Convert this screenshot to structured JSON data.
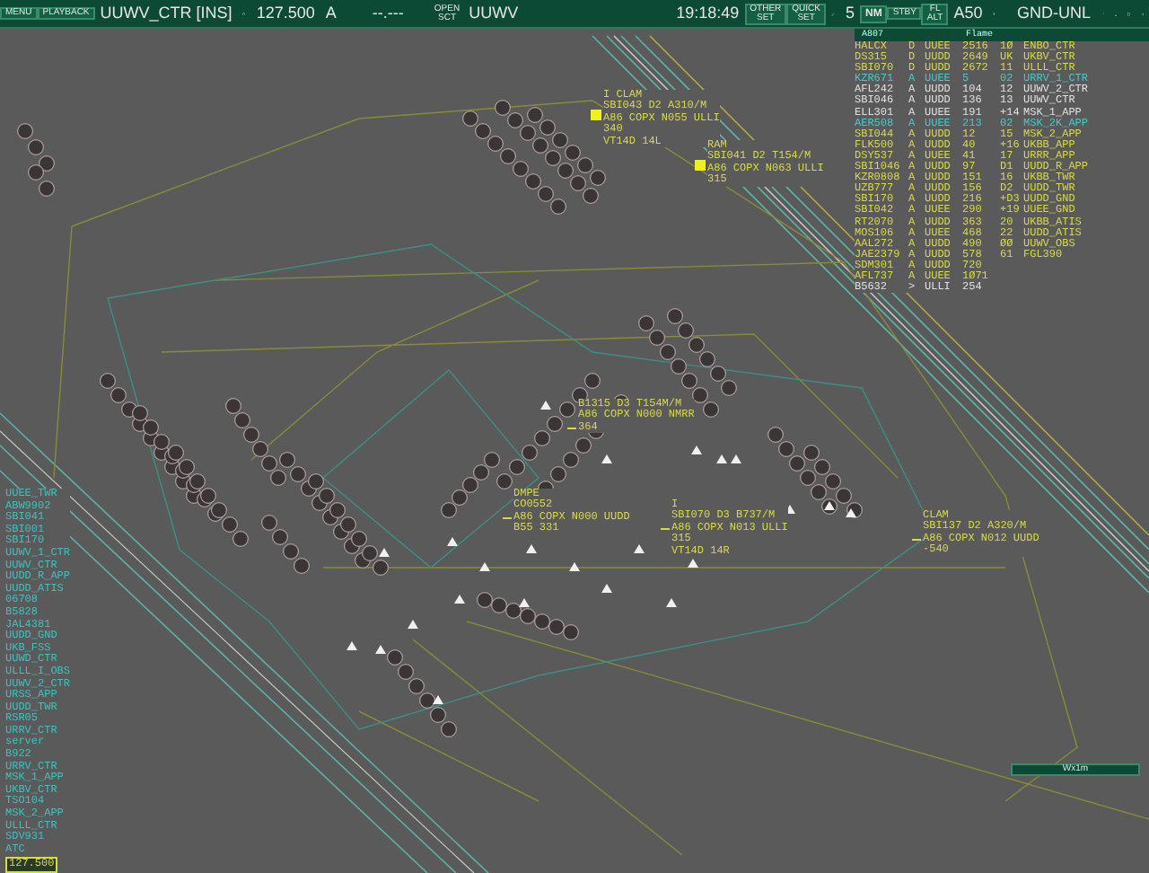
{
  "toolbar": {
    "menu_button": "MENU",
    "playback_button": "PLAYBACK",
    "sector": "UUWV_CTR [INS]",
    "frequency": "127.500",
    "mode": "A",
    "secondary_frequency": "--.---",
    "open_sector_button": [
      "OPEN",
      "SCT"
    ],
    "sector_code": "UUWV",
    "time": "19:18:49",
    "other_set_button": [
      "OTHER",
      "SET"
    ],
    "quick_set_button": [
      "QUICK",
      "SET"
    ],
    "range": "5",
    "unit": "NM",
    "standby_button": [
      "STBY"
    ],
    "fl_alt_button": [
      "FL",
      "ALT"
    ],
    "level": "A50",
    "altitude_filter": "GND-UNL"
  },
  "flight_list": {
    "header": [
      "A807",
      "Flame"
    ],
    "rows": [
      {
        "callsign": "HALCX",
        "type": "D",
        "airport": "UUEE",
        "number": "2516",
        "column_5": "1Ø",
        "position": "ENBO_CTR",
        "color": "#d8d848"
      },
      {
        "callsign": "DS315",
        "type": "D",
        "airport": "UUDD",
        "number": "2649",
        "column_5": "UK",
        "position": "UKBV_CTR",
        "color": "#d8d848"
      },
      {
        "callsign": "SBI070",
        "type": "D",
        "airport": "UUDD",
        "number": "2672",
        "column_5": "11",
        "position": "ULLL_CTR",
        "color": "#d8d848"
      },
      {
        "callsign": "KZR671",
        "type": "A",
        "airport": "UUEE",
        "number": "5",
        "column_5": "02",
        "position": "URRV_1_CTR",
        "color": "#48c8c8"
      },
      {
        "callsign": "AFL242",
        "type": "A",
        "airport": "UUDD",
        "number": "104",
        "column_5": "12",
        "position": "UUWV_2_CTR",
        "color": "#e0e0e0"
      },
      {
        "callsign": "SBI046",
        "type": "A",
        "airport": "UUDD",
        "number": "136",
        "column_5": "13",
        "position": "UUWV_CTR",
        "color": "#e0e0e0"
      },
      {
        "callsign": "ELL301",
        "type": "A",
        "airport": "UUEE",
        "number": "191",
        "column_5": "+14",
        "position": "MSK_1_APP",
        "color": "#e0e0e0"
      },
      {
        "callsign": "AER508",
        "type": "A",
        "airport": "UUEE",
        "number": "213",
        "column_5": "02",
        "position": "MSK_2K_APP",
        "color": "#48c8c8"
      },
      {
        "callsign": "SBI044",
        "type": "A",
        "airport": "UUDD",
        "number": "12",
        "column_5": "15",
        "position": "MSK_2_APP",
        "color": "#d8d848"
      },
      {
        "callsign": "FLK500",
        "type": "A",
        "airport": "UUDD",
        "number": "40",
        "column_5": "+16",
        "position": "UKBB_APP",
        "color": "#d8d848"
      },
      {
        "callsign": "DSY537",
        "type": "A",
        "airport": "UUEE",
        "number": "41",
        "column_5": "17",
        "position": "URRR_APP",
        "color": "#d8d848"
      },
      {
        "callsign": "SBI1046",
        "type": "A",
        "airport": "UUDD",
        "number": "97",
        "column_5": "D1",
        "position": "UUDD_R_APP",
        "color": "#d8d848"
      },
      {
        "callsign": "KZR0808",
        "type": "A",
        "airport": "UUDD",
        "number": "151",
        "column_5": "16",
        "position": "UKBB_TWR",
        "color": "#d8d848"
      },
      {
        "callsign": "UZB777",
        "type": "A",
        "airport": "UUDD",
        "number": "156",
        "column_5": "D2",
        "position": "UUDD_TWR",
        "color": "#d8d848"
      },
      {
        "callsign": "SBI170",
        "type": "A",
        "airport": "UUDD",
        "number": "216",
        "column_5": "+D3",
        "position": "UUDD_GND",
        "color": "#d8d848"
      },
      {
        "callsign": "SBI042",
        "type": "A",
        "airport": "UUEE",
        "number": "290",
        "column_5": "+19",
        "position": "UUEE_GND",
        "color": "#d8d848"
      },
      {
        "callsign": "RT2070",
        "type": "A",
        "airport": "UUDD",
        "number": "363",
        "column_5": "20",
        "position": "UKBB_ATIS",
        "color": "#d8d848"
      },
      {
        "callsign": "MOS106",
        "type": "A",
        "airport": "UUEE",
        "number": "468",
        "column_5": "22",
        "position": "UUDD_ATIS",
        "color": "#d8d848"
      },
      {
        "callsign": "AAL272",
        "type": "A",
        "airport": "UUDD",
        "number": "490",
        "column_5": "ØØ",
        "position": "UUWV_OBS",
        "color": "#d8d848"
      },
      {
        "callsign": "JAE2379",
        "type": "A",
        "airport": "UUDD",
        "number": "578",
        "column_5": "61",
        "position": "FGL390",
        "color": "#d8d848"
      },
      {
        "callsign": "SDM301",
        "type": "A",
        "airport": "UUDD",
        "number": "720",
        "color": "#d8d848"
      },
      {
        "callsign": "AFL737",
        "type": "A",
        "airport": "UUEE",
        "number": "1Ø71",
        "color": "#d8d848"
      },
      {
        "callsign": "B5632",
        "type": ">",
        "airport": "ULLI",
        "number": "254",
        "color": "#e0e0e0"
      }
    ]
  },
  "stations": [
    "UUEE_TWR",
    "ABW9902",
    "SBI041",
    "SBI001",
    "SBI170",
    "UUWV_1_CTR",
    "UUWV_CTR",
    "UUDD_R_APP",
    "UUDD_ATIS",
    "06708",
    "B5828",
    "JAL4381",
    "UUDD_GND",
    "UKB_FSS",
    "UUWD_CTR",
    "ULLL_I_OBS",
    "UUWV_2_CTR",
    "URSS_APP",
    "UUDD_TWR",
    "RSR05",
    "URRV_CTR",
    "server",
    "B922",
    "URRV_CTR",
    "MSK_1_APP",
    "UKBV_CTR",
    "TSO104",
    "MSK_2_APP",
    "ULLL_CTR",
    "SDV931",
    "ATC"
  ],
  "active_frequency": "127.500",
  "data_blocks": [
    {
      "lines": [
        "I CLAM",
        "SBI043 D2 A310/M",
        "A86 COPX N055 ULLI",
        "340",
        "VT14D 14L"
      ],
      "target": true
    },
    {
      "lines": [
        "RAM",
        "SBI041 D2 T154/M",
        "A86 COPX N063 ULLI",
        "315"
      ],
      "target": true
    },
    {
      "lines": [
        "B1315 D3 T154M/M",
        "A86 COPX N000 NMRR",
        "364"
      ],
      "target": false
    },
    {
      "lines": [
        "DMPE",
        "CO0552",
        "A86 COPX N000 UUDD",
        "B55 331"
      ],
      "target": false
    },
    {
      "lines": [
        "I",
        "SBI070 D3 B737/M",
        "A86 COPX N013 ULLI",
        "315",
        "VT14D 14R"
      ],
      "target": false
    },
    {
      "lines": [
        "CLAM",
        "SBI137 D2 A320/M",
        "A86 COPX N012 UUDD",
        "-540"
      ],
      "target": false
    }
  ],
  "wind_panel": {
    "title": "Wx1m"
  }
}
